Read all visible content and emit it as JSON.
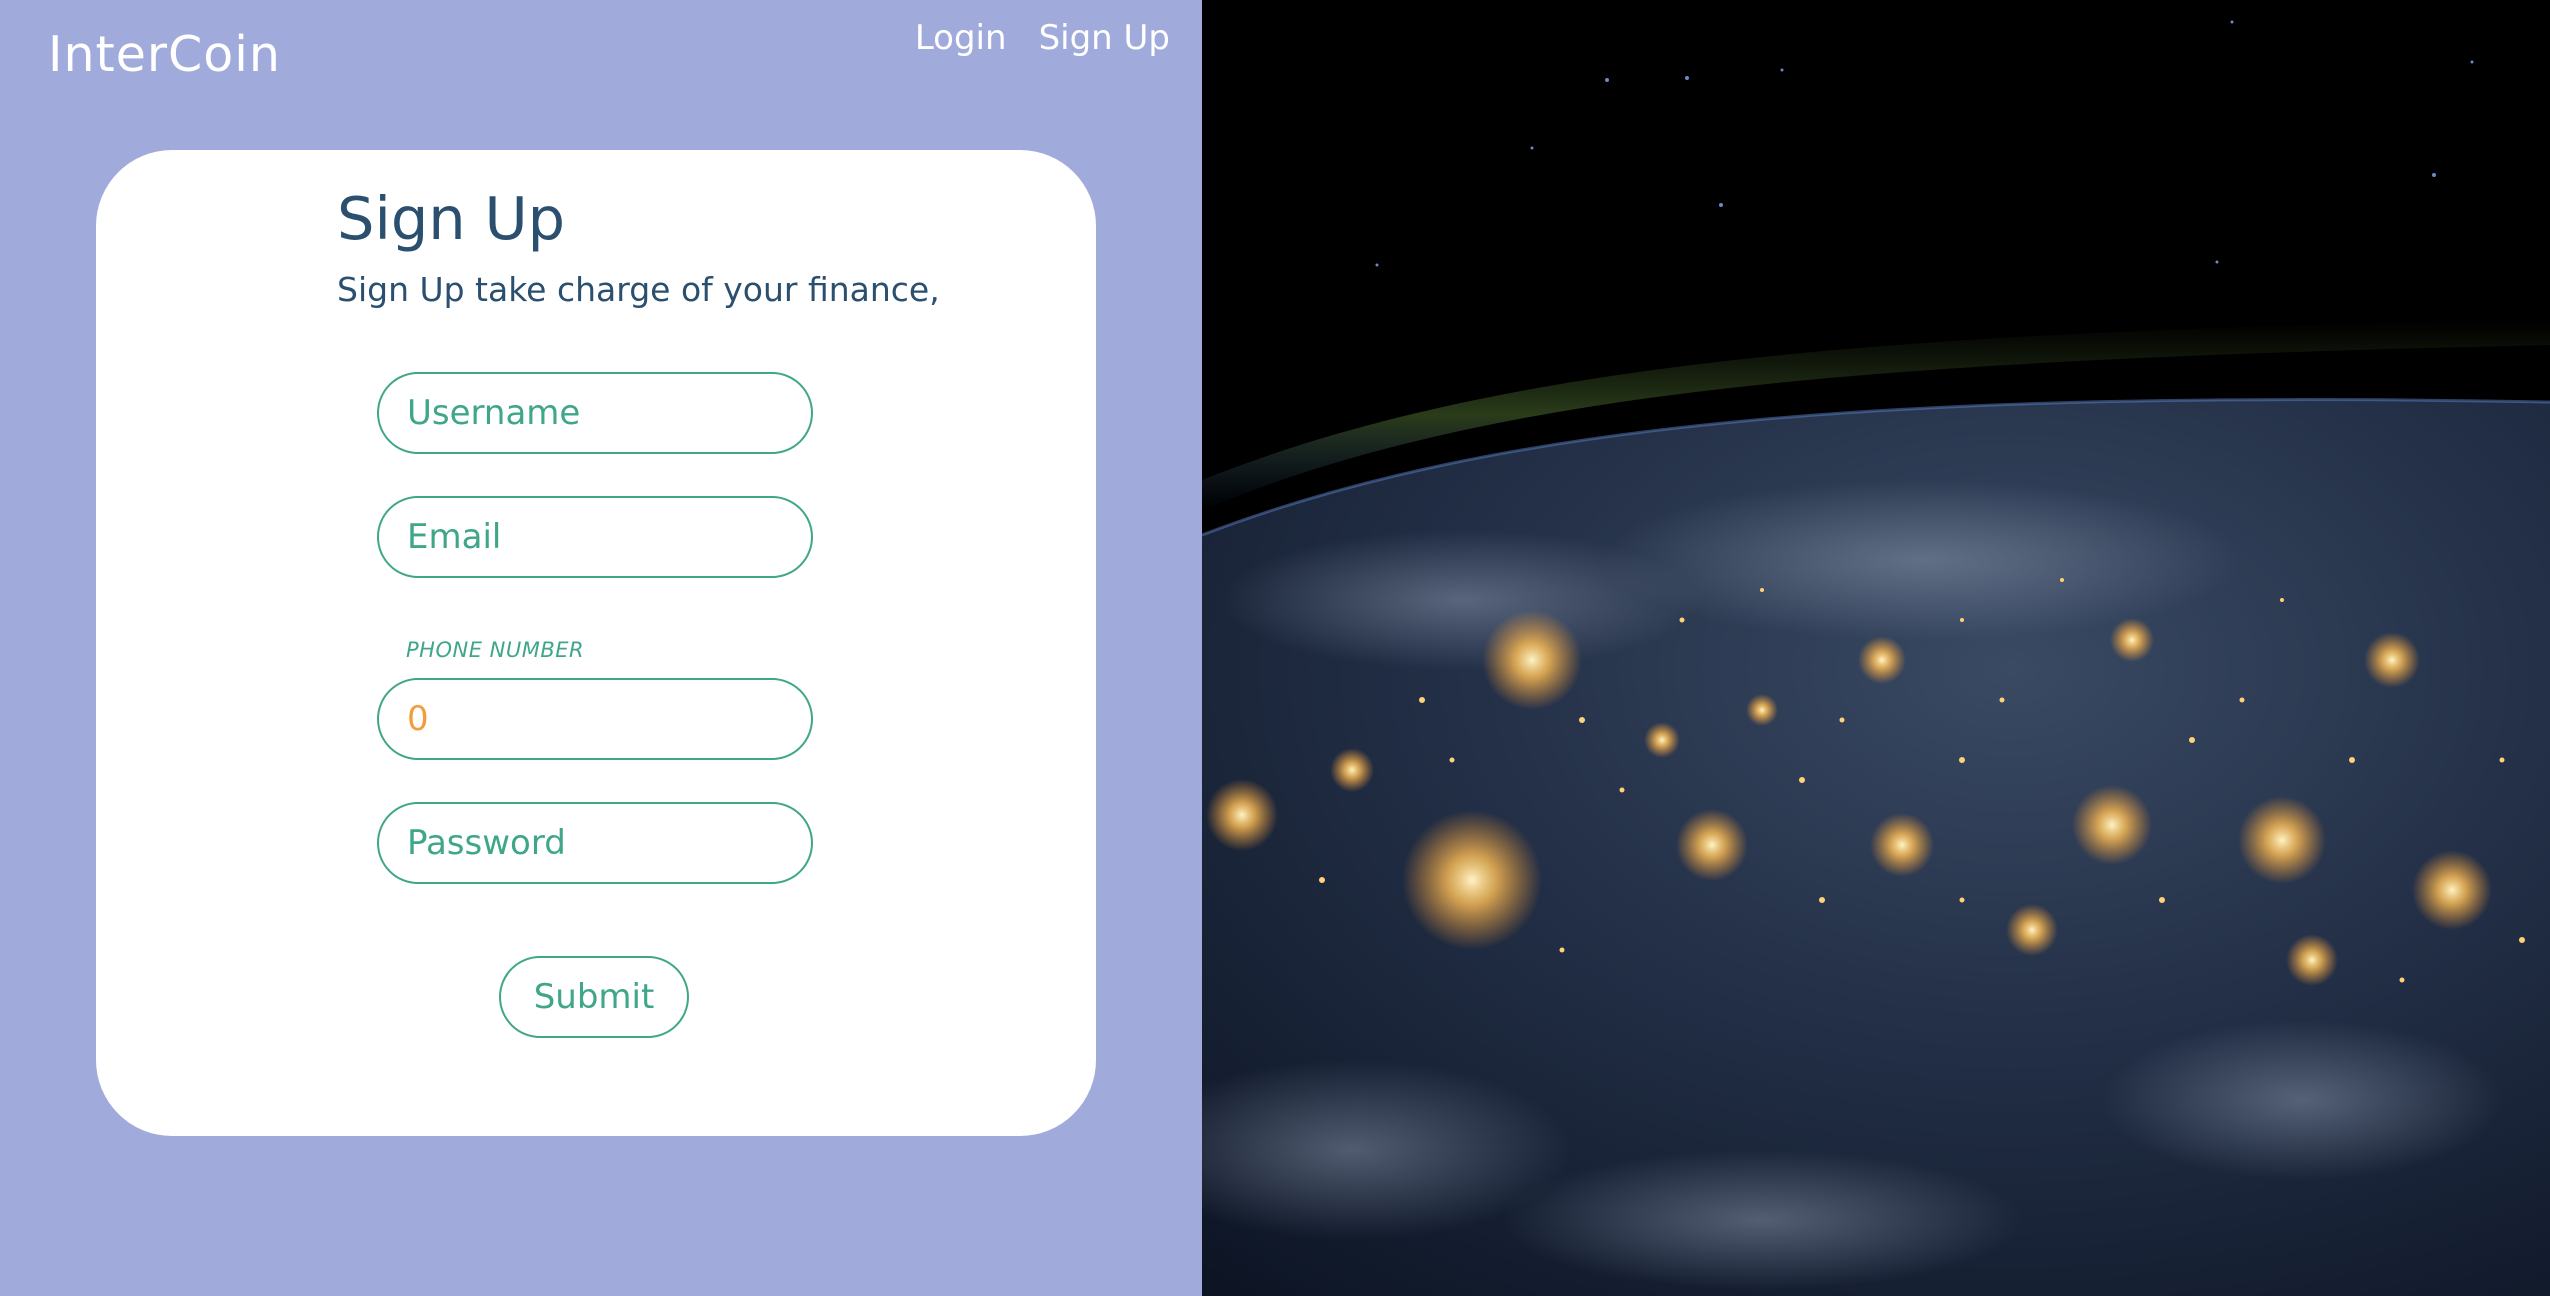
{
  "brand": {
    "name": "InterCoin"
  },
  "nav": {
    "login": "Login",
    "signup": "Sign Up"
  },
  "form": {
    "title": "Sign Up",
    "subtitle": "Sign Up take charge of your finance,",
    "username_placeholder": "Username",
    "email_placeholder": "Email",
    "phone_label": "PHONE NUMBER",
    "phone_value": "0",
    "password_placeholder": "Password",
    "submit_label": "Submit"
  },
  "colors": {
    "left_background": "#a0abdb",
    "accent_green": "#3fa68a",
    "heading_blue": "#2b4f6e",
    "phone_value_orange": "#f39c3c"
  }
}
